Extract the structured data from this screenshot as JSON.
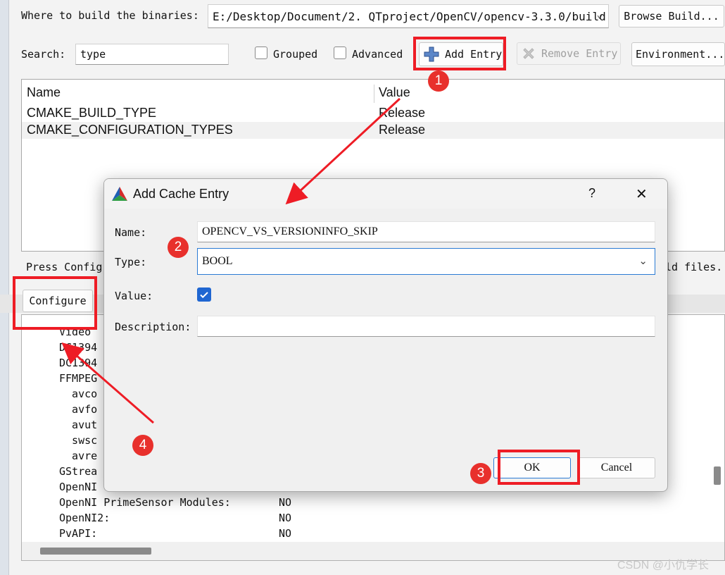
{
  "toolbar": {
    "build_label": "Where to build the binaries:",
    "build_path": "E:/Desktop/Document/2. QTproject/OpenCV/opencv-3.3.0/build",
    "browse_build": "Browse Build...",
    "search_label": "Search:",
    "search_value": "type",
    "grouped": "Grouped",
    "advanced": "Advanced",
    "add_entry": "Add Entry",
    "remove_entry": "Remove Entry",
    "environment": "Environment..."
  },
  "table": {
    "col_name": "Name",
    "col_value": "Value",
    "rows": [
      {
        "name": "CMAKE_BUILD_TYPE",
        "value": "Release"
      },
      {
        "name": "CMAKE_CONFIGURATION_TYPES",
        "value": "Release"
      }
    ]
  },
  "status": {
    "left_text": "Press Config",
    "right_text": "ld files."
  },
  "configure_button": "Configure",
  "output": {
    "lines": [
      {
        "text": "Video"
      },
      {
        "text": "DC1394"
      },
      {
        "text": "DC1394"
      },
      {
        "text": "FFMPEG"
      },
      {
        "text": "  avco"
      },
      {
        "text": "  avfo"
      },
      {
        "text": "  avut"
      },
      {
        "text": "  swsc"
      },
      {
        "text": "  avre"
      },
      {
        "text": "GStrea"
      },
      {
        "text": "OpenNI"
      },
      {
        "text": "OpenNI PrimeSensor Modules:",
        "value": "NO"
      },
      {
        "text": "OpenNI2:",
        "value": "NO"
      },
      {
        "text": "PvAPI:",
        "value": "NO"
      }
    ]
  },
  "dialog": {
    "title": "Add Cache Entry",
    "help": "?",
    "close": "✕",
    "name_label": "Name:",
    "name_value": "OPENCV_VS_VERSIONINFO_SKIP",
    "type_label": "Type:",
    "type_value": "BOOL",
    "value_label": "Value:",
    "value_checked": true,
    "description_label": "Description:",
    "description_value": "",
    "ok": "OK",
    "cancel": "Cancel"
  },
  "annotations": {
    "badges": [
      "1",
      "2",
      "3",
      "4"
    ],
    "color": "#ee1c25"
  },
  "watermark": "CSDN @小仇学长",
  "icons": {
    "add": "plus-icon",
    "remove": "x-icon",
    "app": "cmake-logo-icon",
    "dropdown": "chevron-down-icon"
  }
}
